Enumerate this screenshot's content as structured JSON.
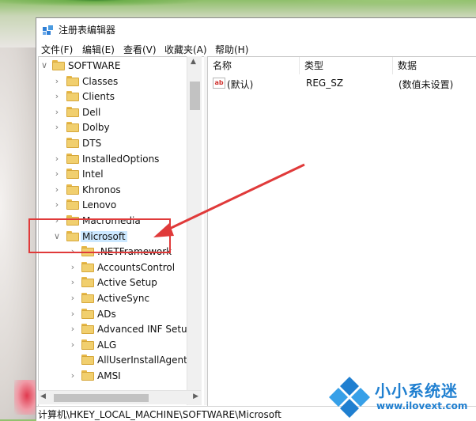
{
  "window": {
    "title": "注册表编辑器"
  },
  "menu": [
    "文件(F)",
    "编辑(E)",
    "查看(V)",
    "收藏夹(A)",
    "帮助(H)"
  ],
  "tree": {
    "root_label": "SOFTWARE",
    "items": [
      {
        "label": "Classes",
        "expandable": true
      },
      {
        "label": "Clients",
        "expandable": true
      },
      {
        "label": "Dell",
        "expandable": true
      },
      {
        "label": "Dolby",
        "expandable": true
      },
      {
        "label": "DTS",
        "expandable": false
      },
      {
        "label": "InstalledOptions",
        "expandable": true
      },
      {
        "label": "Intel",
        "expandable": true
      },
      {
        "label": "Khronos",
        "expandable": true
      },
      {
        "label": "Lenovo",
        "expandable": true
      },
      {
        "label": "Macromedia",
        "expandable": true
      },
      {
        "label": "Microsoft",
        "expandable": true,
        "expanded": true,
        "selected": true
      }
    ],
    "children": [
      {
        "label": ".NETFramework",
        "expandable": true
      },
      {
        "label": "AccountsControl",
        "expandable": true
      },
      {
        "label": "Active Setup",
        "expandable": true
      },
      {
        "label": "ActiveSync",
        "expandable": true
      },
      {
        "label": "ADs",
        "expandable": true
      },
      {
        "label": "Advanced INF Setup",
        "expandable": true
      },
      {
        "label": "ALG",
        "expandable": true
      },
      {
        "label": "AllUserInstallAgent",
        "expandable": false
      },
      {
        "label": "AMSI",
        "expandable": true
      }
    ]
  },
  "list": {
    "columns": [
      "名称",
      "类型",
      "数据"
    ],
    "rows": [
      {
        "name": "(默认)",
        "type": "REG_SZ",
        "data": "(数值未设置)",
        "icon_text": "ab"
      }
    ]
  },
  "status": {
    "path": "计算机\\HKEY_LOCAL_MACHINE\\SOFTWARE\\Microsoft"
  },
  "watermark": {
    "brand": "小小系统迷",
    "url": "www.ilovext.com"
  },
  "colors": {
    "highlight": "#e03a3a",
    "selection": "#cce8ff",
    "folder": "#f1cf6e",
    "brand": "#1f7fd0"
  }
}
